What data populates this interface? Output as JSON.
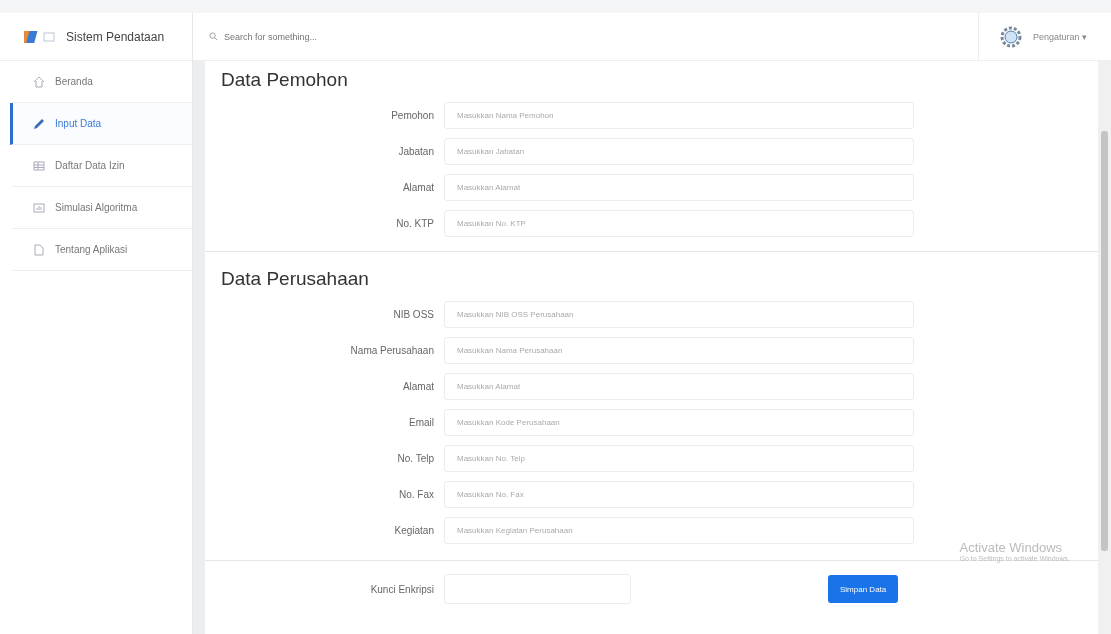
{
  "brand": {
    "title": "Sistem Pendataan"
  },
  "search": {
    "placeholder": "Search for something..."
  },
  "user_menu": {
    "label": "Pengaturan ▾"
  },
  "sidebar": {
    "items": [
      {
        "label": "Beranda",
        "selected": false
      },
      {
        "label": "Input Data",
        "selected": true
      },
      {
        "label": "Daftar Data Izin",
        "selected": false
      },
      {
        "label": "Simulasi Algoritma",
        "selected": false
      },
      {
        "label": "Tentang Aplikasi",
        "selected": false
      }
    ]
  },
  "sections": [
    {
      "title": "Data Pemohon",
      "fields": [
        {
          "label": "Pemohon",
          "placeholder": "Masukkan Nama Pemohon"
        },
        {
          "label": "Jabatan",
          "placeholder": "Masukkan Jabatan"
        },
        {
          "label": "Alamat",
          "placeholder": "Masukkan Alamat"
        },
        {
          "label": "No. KTP",
          "placeholder": "Masukkan No. KTP"
        }
      ]
    },
    {
      "title": "Data Perusahaan",
      "fields": [
        {
          "label": "NIB OSS",
          "placeholder": "Masukkan NIB OSS Perusahaan"
        },
        {
          "label": "Nama Perusahaan",
          "placeholder": "Masukkan Nama Perusahaan"
        },
        {
          "label": "Alamat",
          "placeholder": "Masukkan Alamat"
        },
        {
          "label": "Email",
          "placeholder": "Masukkan Kode Perusahaan"
        },
        {
          "label": "No. Telp",
          "placeholder": "Masukkan No. Telp"
        },
        {
          "label": "No. Fax",
          "placeholder": "Masukkan No. Fax"
        },
        {
          "label": "Kegiatan",
          "placeholder": "Masukkan Kegiatan Perusahaan"
        }
      ]
    }
  ],
  "footer": {
    "key_label": "Kunci Enkripsi",
    "submit": "Simpan Data"
  },
  "os_notice": {
    "title": "Activate Windows",
    "subtitle": "Go to Settings to activate Windows."
  }
}
